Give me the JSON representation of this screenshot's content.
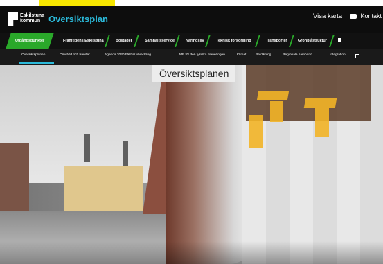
{
  "site": {
    "logo_line1": "Eskilstuna",
    "logo_line2": "kommun",
    "title": "Översiktsplan"
  },
  "header": {
    "visa_karta": "Visa karta",
    "kontakt": "Kontakt"
  },
  "nav_primary": [
    "Utgångspunkter",
    "Framtidens Eskilstuna",
    "Bostäder",
    "Samhällsservice",
    "Näringsliv",
    "Teknisk försörjning",
    "Transporter",
    "Grönblåstruktur"
  ],
  "nav_secondary": [
    "Översiktsplanen",
    "Omvärld och trender",
    "Agenda 2030 hållbar utveckling",
    "MB för den fysiska planeringen",
    "Klimat",
    "Befolkning",
    "Regionala samband",
    "Integration"
  ],
  "hero": {
    "title": "Översiktsplanen"
  },
  "colors": {
    "accent_green": "#2aa82a",
    "accent_blue": "#2bb9d9",
    "header_bg": "#0d0d0d"
  },
  "icons": {
    "menu": "menu-square-icon",
    "kontakt": "chat-bubble-icon"
  }
}
